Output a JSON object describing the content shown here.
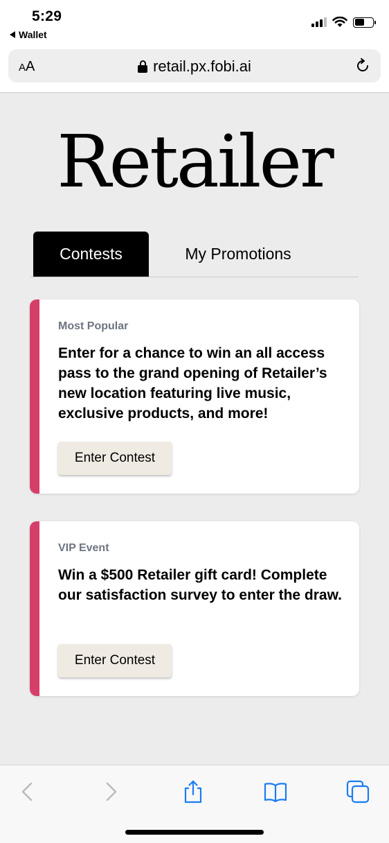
{
  "status_bar": {
    "time": "5:29",
    "back_app": "Wallet",
    "icons": [
      "cellular-signal-icon",
      "wifi-icon",
      "battery-icon"
    ]
  },
  "browser": {
    "text_size_label_small": "A",
    "text_size_label_large": "A",
    "url": "retail.px.fobi.ai",
    "icons": [
      "lock-icon",
      "reload-icon"
    ]
  },
  "page": {
    "logo_text": "Retailer",
    "tabs": [
      {
        "label": "Contests",
        "active": true
      },
      {
        "label": "My Promotions",
        "active": false
      }
    ],
    "contests": [
      {
        "tag": "Most Popular",
        "text": "Enter for a chance to win an all access pass to the grand opening of Retailer’s new location featuring live music, exclusive products, and more!",
        "button_label": "Enter Contest"
      },
      {
        "tag": "VIP Event",
        "text": "Win a $500 Retailer gift card! Complete our satisfaction survey to enter the draw.",
        "button_label": "Enter Contest"
      }
    ]
  },
  "toolbar": {
    "icons": [
      "back-icon",
      "forward-icon",
      "share-icon",
      "bookmarks-icon",
      "tabs-icon"
    ]
  },
  "colors": {
    "accent": "#d63e6a",
    "tag_gray": "#6d7581",
    "button_bg": "#efebe3",
    "page_bg": "#ececec",
    "safari_blue": "#1a7cf4"
  }
}
